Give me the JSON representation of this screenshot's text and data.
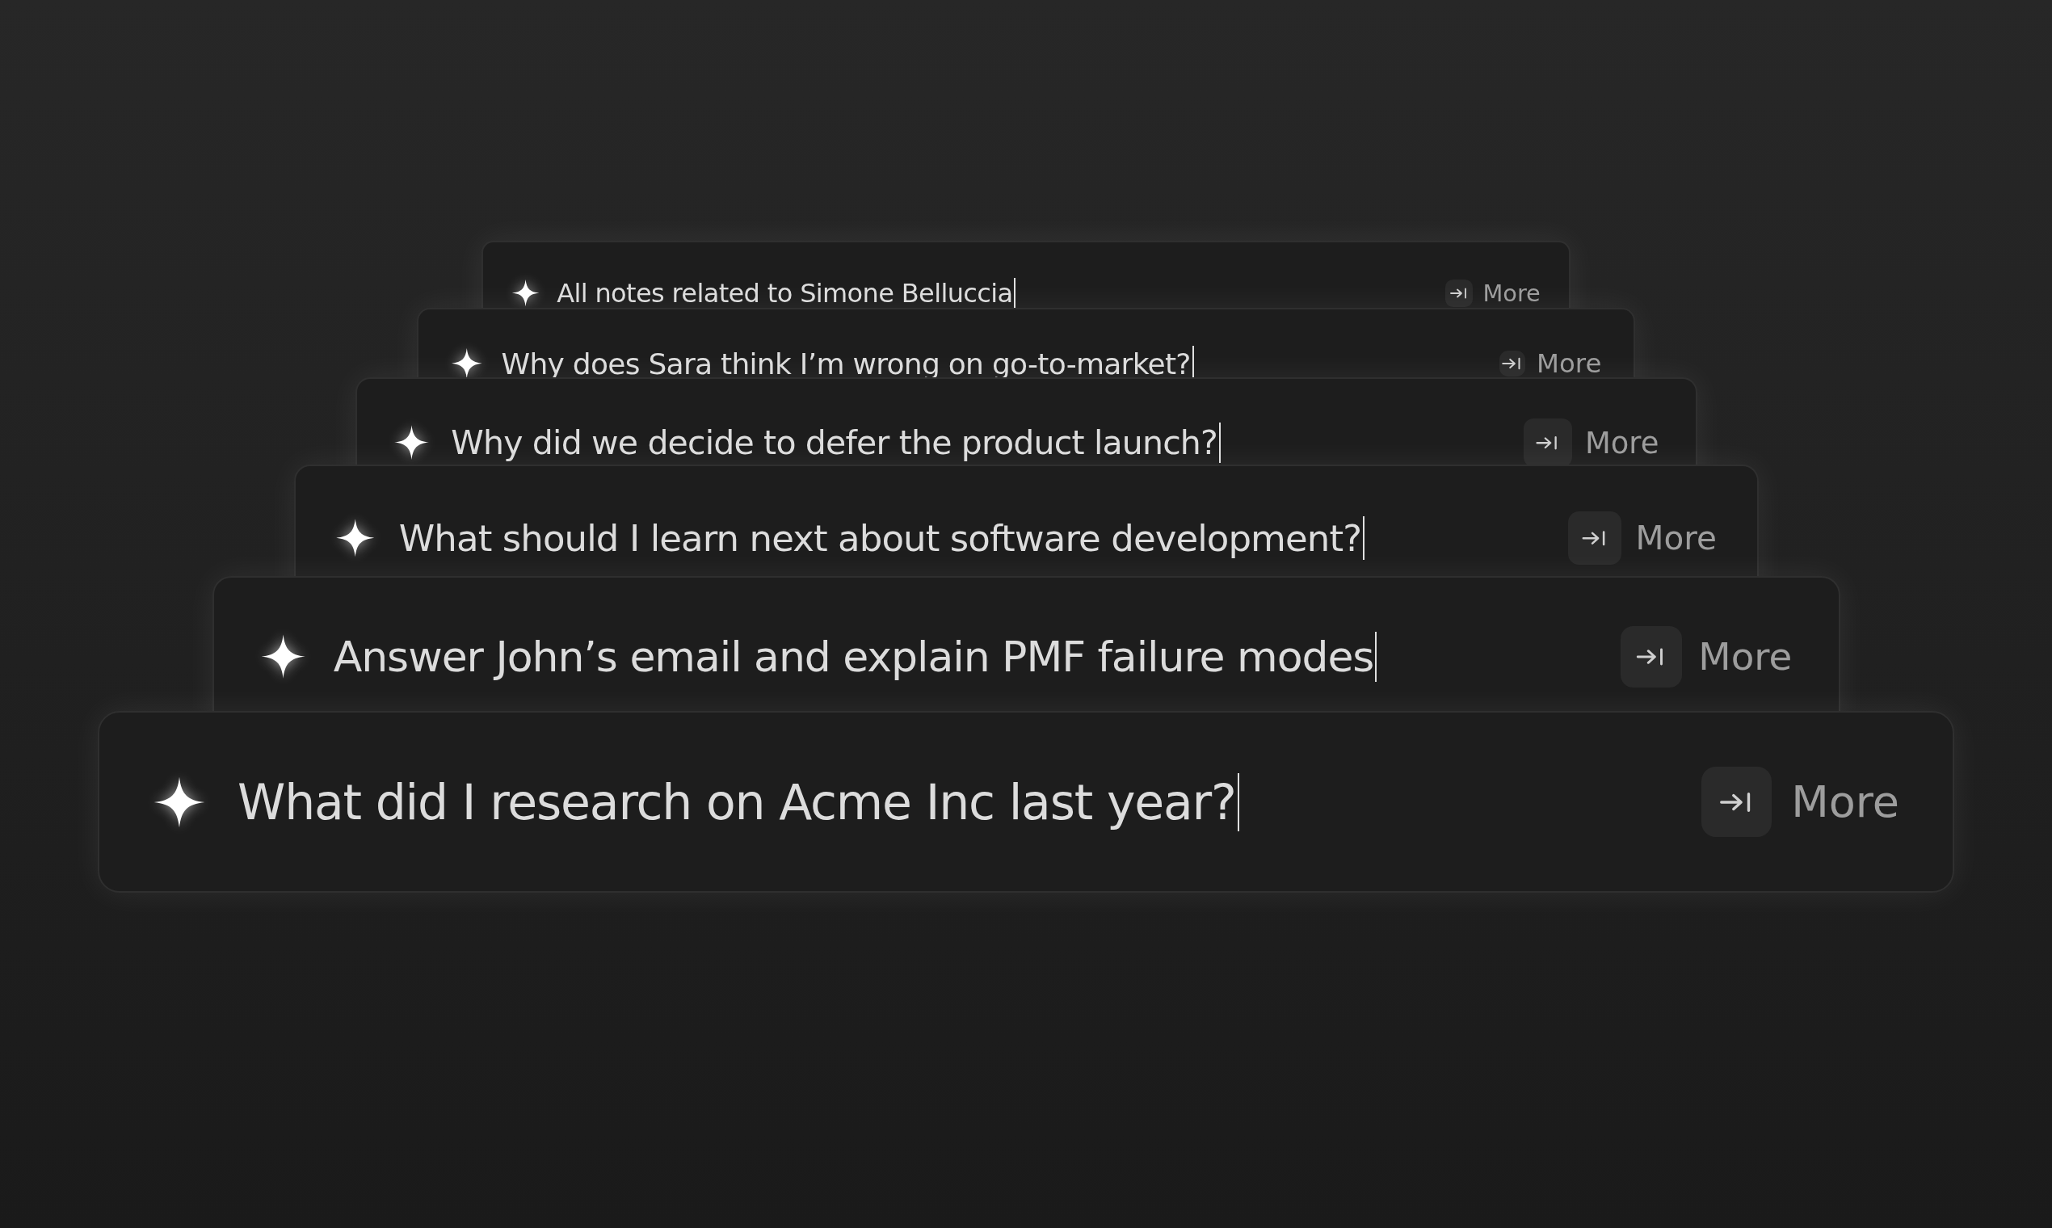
{
  "prompts": [
    {
      "query": "All notes related to Simone Belluccia",
      "cursor": true,
      "hint": "More"
    },
    {
      "query": "Why does Sara think I’m wrong on go-to-market?",
      "cursor": true,
      "hint": "More"
    },
    {
      "query": "Why did we decide to defer the product launch?",
      "cursor": true,
      "hint": "More"
    },
    {
      "query": "What should I learn next about software development?",
      "cursor": true,
      "hint": "More"
    },
    {
      "query": "Answer John’s email and explain PMF failure modes",
      "cursor": true,
      "hint": "More"
    },
    {
      "query": "What did I research on Acme Inc last year?",
      "cursor": true,
      "hint": "More"
    }
  ]
}
